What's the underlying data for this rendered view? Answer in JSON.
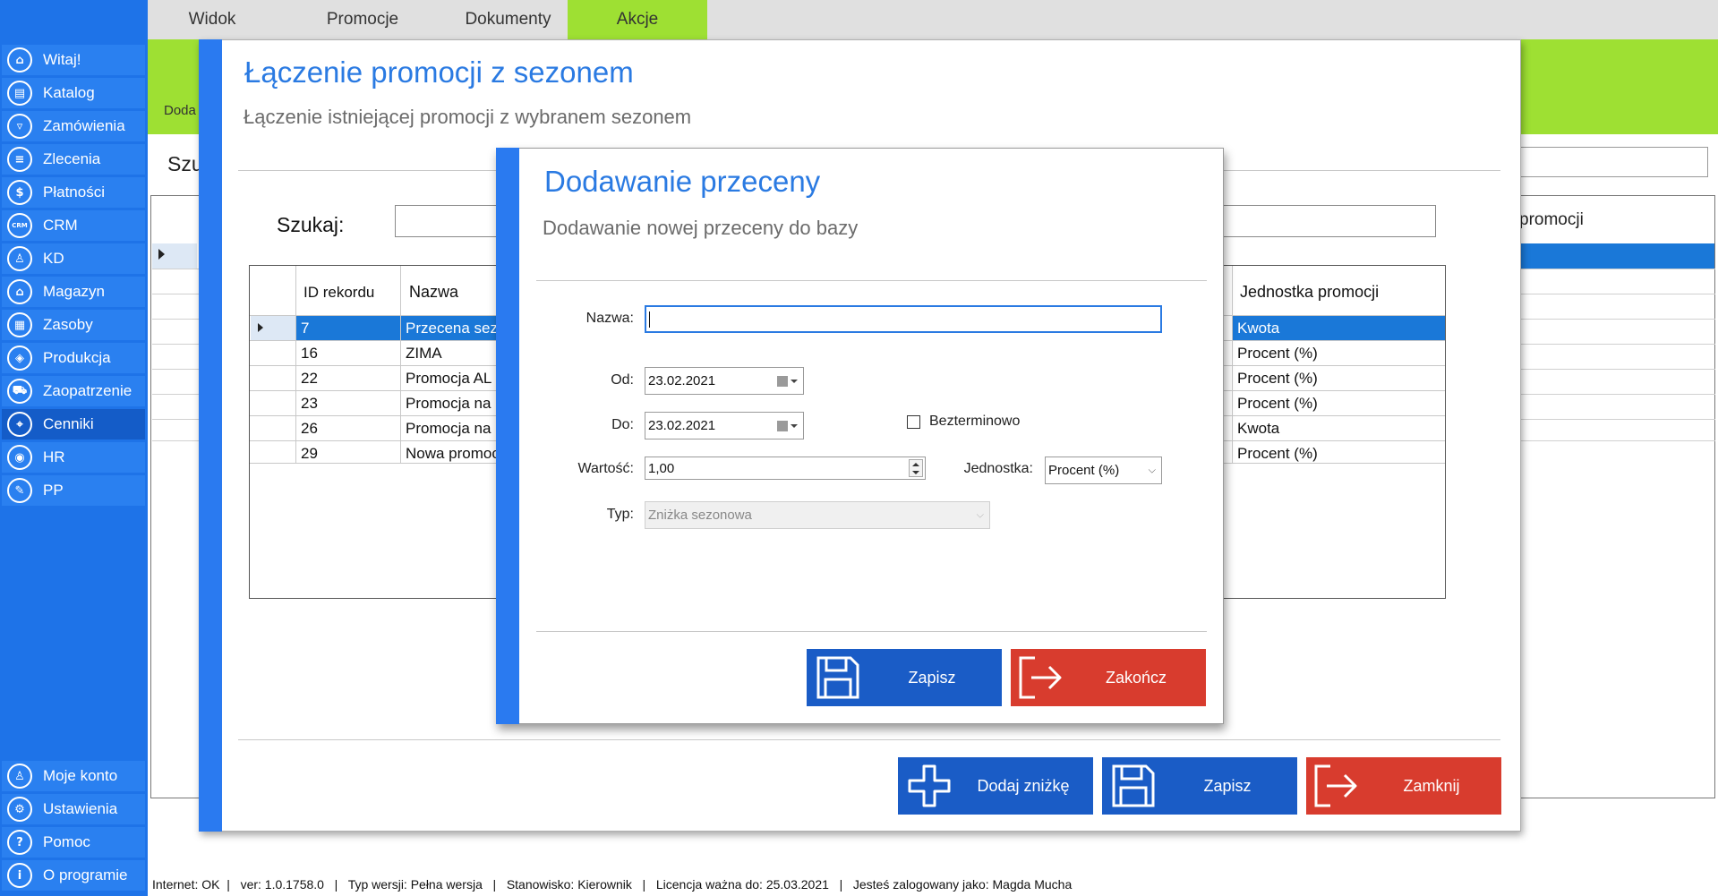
{
  "sidebar": {
    "items": [
      {
        "label": "Witaj!",
        "icon": "home-icon"
      },
      {
        "label": "Katalog",
        "icon": "book-icon"
      },
      {
        "label": "Zamówienia",
        "icon": "cart-icon"
      },
      {
        "label": "Zlecenia",
        "icon": "list-icon"
      },
      {
        "label": "Płatności",
        "icon": "dollar-icon"
      },
      {
        "label": "CRM",
        "icon": "crm-icon"
      },
      {
        "label": "KD",
        "icon": "person-icon"
      },
      {
        "label": "Magazyn",
        "icon": "warehouse-icon"
      },
      {
        "label": "Zasoby",
        "icon": "resources-icon"
      },
      {
        "label": "Produkcja",
        "icon": "production-icon"
      },
      {
        "label": "Zaopatrzenie",
        "icon": "supply-icon"
      },
      {
        "label": "Cenniki",
        "icon": "tag-icon"
      },
      {
        "label": "HR",
        "icon": "hr-icon"
      },
      {
        "label": "PP",
        "icon": "pp-icon"
      }
    ],
    "bottom_items": [
      {
        "label": "Moje konto",
        "icon": "user-icon"
      },
      {
        "label": "Ustawienia",
        "icon": "gear-icon"
      },
      {
        "label": "Pomoc",
        "icon": "help-icon"
      },
      {
        "label": "O programie",
        "icon": "info-icon"
      }
    ]
  },
  "topmenu": {
    "tabs": [
      "Widok",
      "Promocje",
      "Dokumenty",
      "Akcje"
    ],
    "active": "Akcje"
  },
  "background": {
    "breadcrumb": "Doda",
    "search_label": "Szu",
    "column_header": "promocji"
  },
  "dialog1": {
    "title": "Łączenie promocji z sezonem",
    "subtitle": "Łączenie istniejącej promocji z wybranem sezonem",
    "search_label": "Szukaj:",
    "search_value": "",
    "columns": [
      "ID rekordu",
      "Nazwa",
      "Jednostka promocji"
    ],
    "rows": [
      {
        "id": "7",
        "name": "Przecena sez",
        "unit": "Kwota"
      },
      {
        "id": "16",
        "name": "ZIMA",
        "unit": "Procent (%)"
      },
      {
        "id": "22",
        "name": "Promocja AL",
        "unit": "Procent (%)"
      },
      {
        "id": "23",
        "name": "Promocja na",
        "unit": "Procent (%)"
      },
      {
        "id": "26",
        "name": "Promocja na",
        "unit": "Kwota"
      },
      {
        "id": "29",
        "name": "Nowa promoc",
        "unit": "Procent (%)"
      }
    ],
    "buttons": {
      "add": "Dodaj zniżkę",
      "save": "Zapisz",
      "close": "Zamknij"
    }
  },
  "dialog2": {
    "title": "Dodawanie przeceny",
    "subtitle": "Dodawanie nowej przeceny do bazy",
    "fields": {
      "name_label": "Nazwa:",
      "name_value": "",
      "from_label": "Od:",
      "from_value": "23.02.2021",
      "to_label": "Do:",
      "to_value": "23.02.2021",
      "indefinite_label": "Bezterminowo",
      "value_label": "Wartość:",
      "value_value": "1,00",
      "unit_label": "Jednostka:",
      "unit_value": "Procent (%)",
      "type_label": "Typ:",
      "type_value": "Zniżka sezonowa"
    },
    "buttons": {
      "save": "Zapisz",
      "finish": "Zakończ"
    }
  },
  "status": {
    "text": "Internet: OK  |   ver: 1.0.1758.0   |   Typ wersji: Pełna wersja   |   Stanowisko: Kierownik   |   Licencja ważna do: 25.03.2021   |   Jesteś zalogowany jako: Magda Mucha"
  },
  "colors": {
    "sidebar": "#1e73e8",
    "accent_green": "#9ee033",
    "primary_blue": "#1a5cc6",
    "danger_red": "#d83c2e",
    "title_blue": "#2a7ae2"
  }
}
